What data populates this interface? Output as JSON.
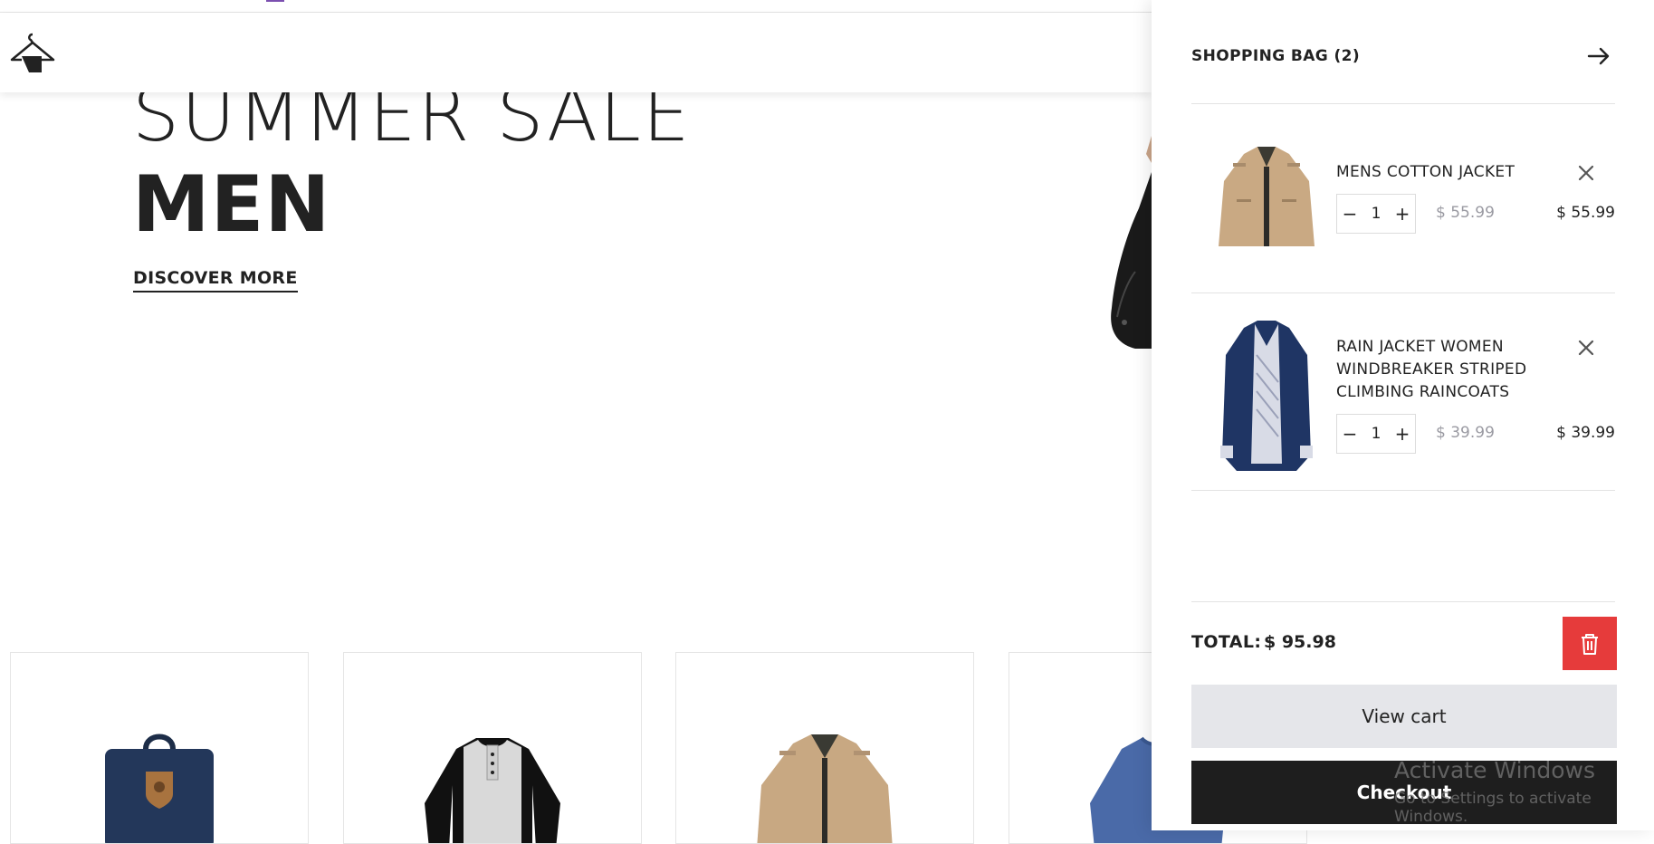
{
  "hero": {
    "subtitle": "SUMMER SALE",
    "title": "MEN",
    "cta": "DISCOVER MORE"
  },
  "header": {
    "logo_icon": "hanger-logo-icon"
  },
  "products": [
    {
      "image": "backpack-image"
    },
    {
      "image": "henley-shirt-image"
    },
    {
      "image": "cotton-jacket-image"
    },
    {
      "image": "blue-tshirt-image"
    }
  ],
  "cart": {
    "title": "SHOPPING BAG (2)",
    "close_icon": "arrow-right-icon",
    "items": [
      {
        "name": "MENS COTTON JACKET",
        "quantity": "1",
        "unit_price": "$ 55.99",
        "line_total": "$ 55.99",
        "image": "khaki-jacket-image"
      },
      {
        "name": "RAIN JACKET WOMEN WINDBREAKER STRIPED CLIMBING RAINCOATS",
        "quantity": "1",
        "unit_price": "$ 39.99",
        "line_total": "$ 39.99",
        "image": "navy-raincoat-image"
      }
    ],
    "total_label": "TOTAL:",
    "total_value": "$ 95.98",
    "clear_icon": "trash-icon",
    "view_cart_label": "View cart",
    "checkout_label": "Checkout",
    "colors": {
      "clear_button": "#e63b3b",
      "checkout_button": "#1e1e1e",
      "view_cart_button": "#e5e6ea"
    }
  },
  "watermark": {
    "line1": "Activate Windows",
    "line2": "Go to Settings to activate Windows."
  }
}
